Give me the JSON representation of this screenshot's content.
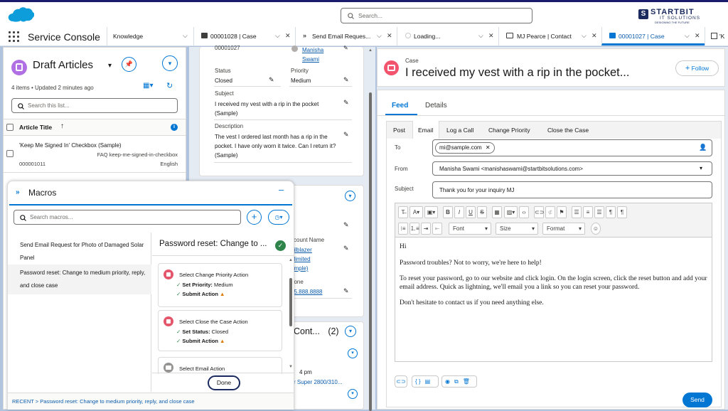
{
  "header": {
    "search_placeholder": "Search...",
    "brand_name": "STARTBIT",
    "brand_sub": "IT SOLUTIONS",
    "brand_tagline": "DESIGNING THE FUTURE"
  },
  "nav": {
    "app_name": "Service Console",
    "selector": "Knowledge",
    "tabs": [
      {
        "label": "00001028 | Case"
      },
      {
        "label": "Send Email Reques..."
      },
      {
        "label": "Loading..."
      },
      {
        "label": "MJ Pearce | Contact"
      },
      {
        "label": "00001027 | Case"
      },
      {
        "label": "'K"
      }
    ]
  },
  "draft": {
    "title": "Draft Articles",
    "meta": "4 items • Updated 2 minutes ago",
    "search_placeholder": "Search this list...",
    "column_title": "Article Title",
    "row_title": "'Keep Me Signed In' Checkbox (Sample)",
    "row_sub": "FAQ keep-me-signed-in-checkbox",
    "row_num": "000001011",
    "row_lang": "English"
  },
  "macros": {
    "title": "Macros",
    "search_placeholder": "Search macros...",
    "list": [
      "Send Email Request for Photo of Damaged Solar Panel",
      "Password reset: Change to medium priority, reply, and close case"
    ],
    "detail_title": "Password reset: Change to ...",
    "steps": [
      {
        "title": "Select Change Priority Action",
        "lines": [
          {
            "k": "Set Priority:",
            "v": " Medium"
          },
          {
            "k": "Submit Action",
            "v": ""
          }
        ]
      },
      {
        "title": "Select Close the Case Action",
        "lines": [
          {
            "k": "Set Status:",
            "v": " Closed"
          },
          {
            "k": "Submit Action",
            "v": ""
          }
        ]
      },
      {
        "title": "Select Email Action"
      }
    ],
    "done": "Done",
    "recent": "RECENT > Password reset: Change to medium priority, reply, and close case"
  },
  "detail": {
    "top_num": "00001027",
    "owner": "Manisha Swami",
    "status_label": "Status",
    "status_value": "Closed",
    "priority_label": "Priority",
    "priority_value": "Medium",
    "subject_label": "Subject",
    "subject_value": "I received my vest with a rip in the pocket (Sample)",
    "desc_label": "Description",
    "desc_value": "The vest I ordered last month has a rip in the pocket. I have only worn it twice. Can I return it? (Sample)",
    "account_label": "ccount Name",
    "account_value": "ailblazer nlimited ample)",
    "phone_label": "hone",
    "phone_value": "05.888.8888",
    "contacts_label": "Cont...",
    "contacts_count": "(2)",
    "time": "4 pm",
    "product": "r Super 2800/310..."
  },
  "case": {
    "object": "Case",
    "title": "I received my vest with a rip in the pocket...",
    "follow": "Follow",
    "tabs": [
      "Feed",
      "Details"
    ],
    "actions": [
      "Post",
      "Email",
      "Log a Call",
      "Change Priority",
      "Close the Case"
    ],
    "to_label": "To",
    "to_value": "mi@sample.com",
    "from_label": "From",
    "from_value": "Manisha Swami <manishaswami@startbitsolutions.com>",
    "subject_label": "Subject",
    "subject_value": "Thank you for your inquiry MJ",
    "font": "Font",
    "size": "Size",
    "format": "Format",
    "body": [
      "Hi",
      "Password troubles? Not to worry, we're here to help!",
      "To reset your password, go to our website and click login. On the login screen, click the reset button and add your email address. Quick as lightning, we'll email you a link so you can reset your password.",
      "Don't hesitate to contact us if you need anything else."
    ],
    "send": "Send"
  }
}
